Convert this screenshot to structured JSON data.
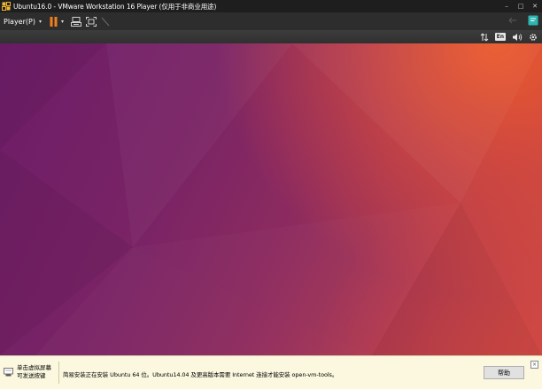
{
  "window": {
    "title": "Ubuntu16.0 - VMware Workstation 16 Player (仅用于非商业用途)",
    "icon": "vmware-player-icon",
    "controls": {
      "minimize": "–",
      "maximize": "□",
      "close": "✕"
    }
  },
  "toolbar": {
    "player_menu_label": "Player(P)",
    "caret": "▾",
    "icons": [
      "pause-icon",
      "send-ctrl-alt-del-icon",
      "fullscreen-icon",
      "unity-icon",
      "chat-icon"
    ],
    "accent_color": "#f0801e"
  },
  "status_tray": {
    "icons": [
      "network-updown-icon",
      "keyboard-layout-icon",
      "volume-icon",
      "settings-gear-icon"
    ],
    "keyboard_layout_label": "En"
  },
  "desktop": {
    "wallpaper_colors": [
      "#6c1d68",
      "#8d2b5f",
      "#cf4b3f",
      "#ee5c2a"
    ]
  },
  "notification": {
    "hint_line1": "单击虚拟屏幕",
    "hint_line2": "可发送按键",
    "message": "简易安装正在安装 Ubuntu 64 位。Ubuntu14.04 及更高版本需要 Internet 连接才能安装 open-vm-tools。",
    "help_button_label": "帮助",
    "close_label": "×"
  }
}
